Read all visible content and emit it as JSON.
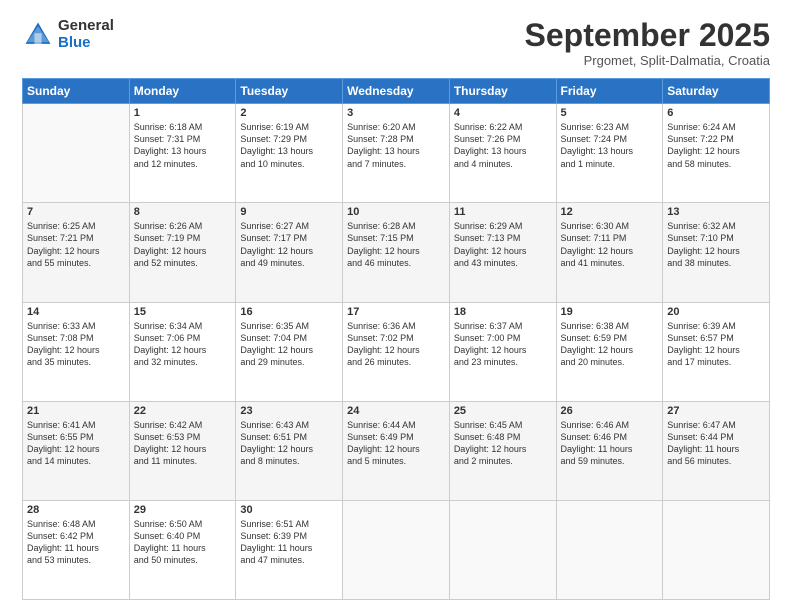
{
  "logo": {
    "general": "General",
    "blue": "Blue"
  },
  "header": {
    "title": "September 2025",
    "location": "Prgomet, Split-Dalmatia, Croatia"
  },
  "weekdays": [
    "Sunday",
    "Monday",
    "Tuesday",
    "Wednesday",
    "Thursday",
    "Friday",
    "Saturday"
  ],
  "weeks": [
    [
      {
        "day": "",
        "info": ""
      },
      {
        "day": "1",
        "info": "Sunrise: 6:18 AM\nSunset: 7:31 PM\nDaylight: 13 hours\nand 12 minutes."
      },
      {
        "day": "2",
        "info": "Sunrise: 6:19 AM\nSunset: 7:29 PM\nDaylight: 13 hours\nand 10 minutes."
      },
      {
        "day": "3",
        "info": "Sunrise: 6:20 AM\nSunset: 7:28 PM\nDaylight: 13 hours\nand 7 minutes."
      },
      {
        "day": "4",
        "info": "Sunrise: 6:22 AM\nSunset: 7:26 PM\nDaylight: 13 hours\nand 4 minutes."
      },
      {
        "day": "5",
        "info": "Sunrise: 6:23 AM\nSunset: 7:24 PM\nDaylight: 13 hours\nand 1 minute."
      },
      {
        "day": "6",
        "info": "Sunrise: 6:24 AM\nSunset: 7:22 PM\nDaylight: 12 hours\nand 58 minutes."
      }
    ],
    [
      {
        "day": "7",
        "info": "Sunrise: 6:25 AM\nSunset: 7:21 PM\nDaylight: 12 hours\nand 55 minutes."
      },
      {
        "day": "8",
        "info": "Sunrise: 6:26 AM\nSunset: 7:19 PM\nDaylight: 12 hours\nand 52 minutes."
      },
      {
        "day": "9",
        "info": "Sunrise: 6:27 AM\nSunset: 7:17 PM\nDaylight: 12 hours\nand 49 minutes."
      },
      {
        "day": "10",
        "info": "Sunrise: 6:28 AM\nSunset: 7:15 PM\nDaylight: 12 hours\nand 46 minutes."
      },
      {
        "day": "11",
        "info": "Sunrise: 6:29 AM\nSunset: 7:13 PM\nDaylight: 12 hours\nand 43 minutes."
      },
      {
        "day": "12",
        "info": "Sunrise: 6:30 AM\nSunset: 7:11 PM\nDaylight: 12 hours\nand 41 minutes."
      },
      {
        "day": "13",
        "info": "Sunrise: 6:32 AM\nSunset: 7:10 PM\nDaylight: 12 hours\nand 38 minutes."
      }
    ],
    [
      {
        "day": "14",
        "info": "Sunrise: 6:33 AM\nSunset: 7:08 PM\nDaylight: 12 hours\nand 35 minutes."
      },
      {
        "day": "15",
        "info": "Sunrise: 6:34 AM\nSunset: 7:06 PM\nDaylight: 12 hours\nand 32 minutes."
      },
      {
        "day": "16",
        "info": "Sunrise: 6:35 AM\nSunset: 7:04 PM\nDaylight: 12 hours\nand 29 minutes."
      },
      {
        "day": "17",
        "info": "Sunrise: 6:36 AM\nSunset: 7:02 PM\nDaylight: 12 hours\nand 26 minutes."
      },
      {
        "day": "18",
        "info": "Sunrise: 6:37 AM\nSunset: 7:00 PM\nDaylight: 12 hours\nand 23 minutes."
      },
      {
        "day": "19",
        "info": "Sunrise: 6:38 AM\nSunset: 6:59 PM\nDaylight: 12 hours\nand 20 minutes."
      },
      {
        "day": "20",
        "info": "Sunrise: 6:39 AM\nSunset: 6:57 PM\nDaylight: 12 hours\nand 17 minutes."
      }
    ],
    [
      {
        "day": "21",
        "info": "Sunrise: 6:41 AM\nSunset: 6:55 PM\nDaylight: 12 hours\nand 14 minutes."
      },
      {
        "day": "22",
        "info": "Sunrise: 6:42 AM\nSunset: 6:53 PM\nDaylight: 12 hours\nand 11 minutes."
      },
      {
        "day": "23",
        "info": "Sunrise: 6:43 AM\nSunset: 6:51 PM\nDaylight: 12 hours\nand 8 minutes."
      },
      {
        "day": "24",
        "info": "Sunrise: 6:44 AM\nSunset: 6:49 PM\nDaylight: 12 hours\nand 5 minutes."
      },
      {
        "day": "25",
        "info": "Sunrise: 6:45 AM\nSunset: 6:48 PM\nDaylight: 12 hours\nand 2 minutes."
      },
      {
        "day": "26",
        "info": "Sunrise: 6:46 AM\nSunset: 6:46 PM\nDaylight: 11 hours\nand 59 minutes."
      },
      {
        "day": "27",
        "info": "Sunrise: 6:47 AM\nSunset: 6:44 PM\nDaylight: 11 hours\nand 56 minutes."
      }
    ],
    [
      {
        "day": "28",
        "info": "Sunrise: 6:48 AM\nSunset: 6:42 PM\nDaylight: 11 hours\nand 53 minutes."
      },
      {
        "day": "29",
        "info": "Sunrise: 6:50 AM\nSunset: 6:40 PM\nDaylight: 11 hours\nand 50 minutes."
      },
      {
        "day": "30",
        "info": "Sunrise: 6:51 AM\nSunset: 6:39 PM\nDaylight: 11 hours\nand 47 minutes."
      },
      {
        "day": "",
        "info": ""
      },
      {
        "day": "",
        "info": ""
      },
      {
        "day": "",
        "info": ""
      },
      {
        "day": "",
        "info": ""
      }
    ]
  ]
}
